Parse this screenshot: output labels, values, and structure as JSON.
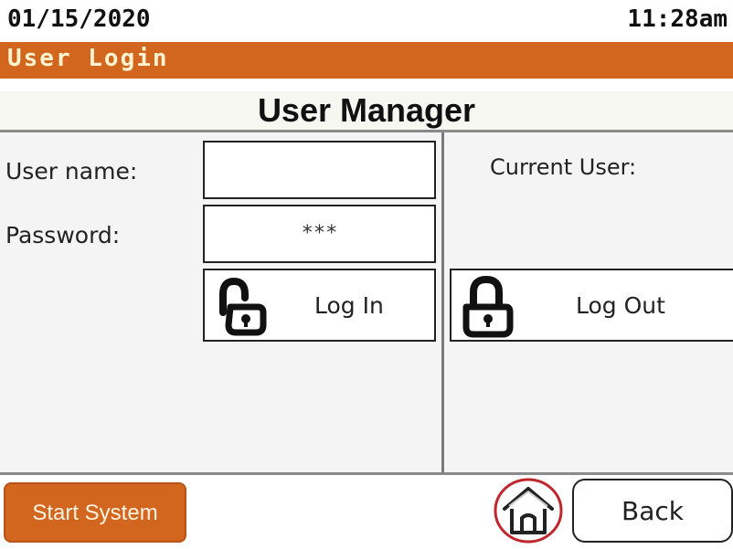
{
  "status_bar": {
    "date": "01/15/2020",
    "time": "11:28am"
  },
  "header": {
    "screen_name": "User Login",
    "title": "User Manager"
  },
  "login_panel": {
    "username_label": "User name:",
    "username_value": "",
    "password_label": "Password:",
    "password_value": "***",
    "login_button": {
      "label": "Log In",
      "icon": "unlocked-padlock-icon"
    }
  },
  "user_panel": {
    "current_user_label": "Current User:",
    "logout_button": {
      "label": "Log Out",
      "icon": "locked-padlock-icon"
    }
  },
  "footer": {
    "start_button": "Start System",
    "home_button_icon": "home-icon",
    "back_button": "Back"
  },
  "colors": {
    "accent": "#d2661e",
    "panel_bg": "#f4f4f4",
    "home_ring": "#c0272d"
  }
}
